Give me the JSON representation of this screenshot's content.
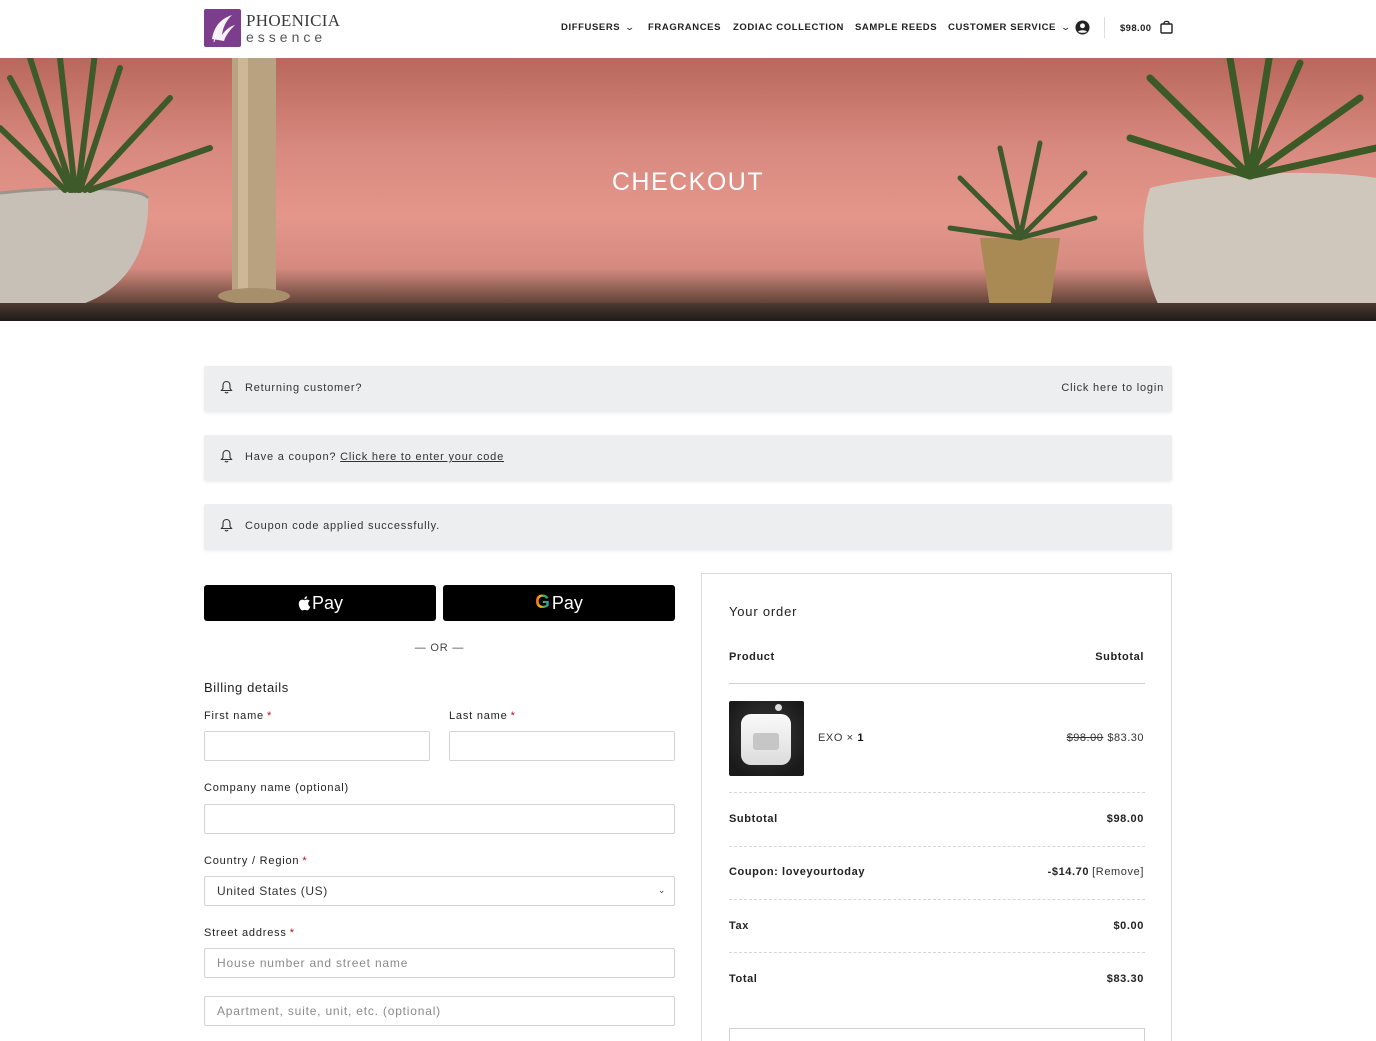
{
  "brand": {
    "name_top": "PHOENICIA",
    "name_bottom": "essence"
  },
  "nav": {
    "items": [
      {
        "label": "DIFFUSERS",
        "has_dropdown": true
      },
      {
        "label": "FRAGRANCES",
        "has_dropdown": false
      },
      {
        "label": "ZODIAC COLLECTION",
        "has_dropdown": false
      },
      {
        "label": "SAMPLE REEDS",
        "has_dropdown": false
      },
      {
        "label": "CUSTOMER SERVICE",
        "has_dropdown": true
      }
    ],
    "cart_total": "$98.00",
    "icons": [
      "account-icon",
      "cart-icon",
      "chevron-down-icon"
    ]
  },
  "hero": {
    "title": "CHECKOUT"
  },
  "notices": {
    "returning": {
      "text": "Returning customer?",
      "link": "Click here to login"
    },
    "coupon": {
      "text": "Have a coupon? ",
      "link": "Click here to enter your code"
    },
    "applied": {
      "text": "Coupon code applied successfully."
    }
  },
  "payment": {
    "apple_pay_label": "Pay",
    "google_pay_label": "Pay",
    "google_g": "G",
    "or_separator": "— OR —"
  },
  "billing": {
    "title": "Billing details",
    "required_mark": "*",
    "first_name": {
      "label": "First name",
      "value": ""
    },
    "last_name": {
      "label": "Last name",
      "value": ""
    },
    "company": {
      "label": "Company name (optional)",
      "value": ""
    },
    "country": {
      "label": "Country / Region",
      "value": "United States (US)"
    },
    "street": {
      "label": "Street address",
      "placeholder_1": "House number and street name",
      "placeholder_2": "Apartment, suite, unit, etc. (optional)"
    }
  },
  "order": {
    "title": "Your order",
    "col_product": "Product",
    "col_subtotal": "Subtotal",
    "items": [
      {
        "name": "EXO",
        "qty_sep": " × ",
        "qty": "1",
        "old_price": "$98.00",
        "price": "$83.30"
      }
    ],
    "subtotal_label": "Subtotal",
    "subtotal_value": "$98.00",
    "coupon_label": "Coupon: loveyourtoday",
    "coupon_value": "-$14.70",
    "coupon_remove": "[Remove]",
    "tax_label": "Tax",
    "tax_value": "$0.00",
    "total_label": "Total",
    "total_value": "$83.30"
  },
  "colors": {
    "brand_purple": "#7b3d8c",
    "notice_bg": "#edeef0",
    "required_red": "#b5121b",
    "pay_button": "#000000"
  }
}
